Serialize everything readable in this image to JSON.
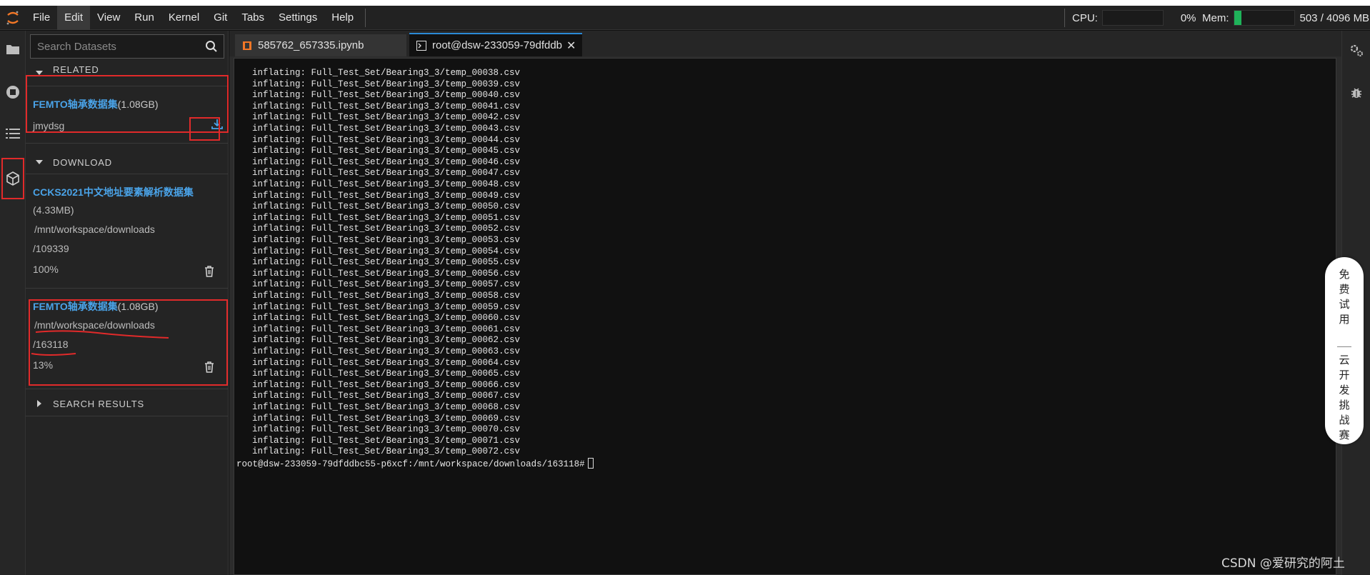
{
  "menubar": {
    "items": [
      "File",
      "Edit",
      "View",
      "Run",
      "Kernel",
      "Git",
      "Tabs",
      "Settings",
      "Help"
    ],
    "active": "Edit",
    "cpu": {
      "label": "CPU:",
      "percent_text": "0%",
      "usage": 0.0
    },
    "mem": {
      "label": "Mem:",
      "value_text": "503 / 4096 MB",
      "usage": 0.12
    }
  },
  "sidebar": {
    "search_placeholder": "Search Datasets",
    "related": {
      "header": "RELATED",
      "item": {
        "name": "FEMTO轴承数据集",
        "size": "(1.08GB)",
        "owner": "jmydsg"
      }
    },
    "download": {
      "header": "DOWNLOAD",
      "items": [
        {
          "name": "CCKS2021中文地址要素解析数据集",
          "size": "(4.33MB)",
          "path1": "/mnt/workspace/downloads",
          "path2": "/109339",
          "progress": "100%"
        },
        {
          "name": "FEMTO轴承数据集",
          "size": "(1.08GB)",
          "path1": "/mnt/workspace/downloads",
          "path2": "/163118",
          "progress": "13%"
        }
      ]
    },
    "search_results": {
      "header": "SEARCH RESULTS"
    }
  },
  "tabs": [
    {
      "label": "585762_657335.ipynb",
      "active": false
    },
    {
      "label": "root@dsw-233059-79dfddb",
      "active": true
    }
  ],
  "terminal": {
    "lines": [
      "  inflating: Full_Test_Set/Bearing3_3/temp_00038.csv",
      "  inflating: Full_Test_Set/Bearing3_3/temp_00039.csv",
      "  inflating: Full_Test_Set/Bearing3_3/temp_00040.csv",
      "  inflating: Full_Test_Set/Bearing3_3/temp_00041.csv",
      "  inflating: Full_Test_Set/Bearing3_3/temp_00042.csv",
      "  inflating: Full_Test_Set/Bearing3_3/temp_00043.csv",
      "  inflating: Full_Test_Set/Bearing3_3/temp_00044.csv",
      "  inflating: Full_Test_Set/Bearing3_3/temp_00045.csv",
      "  inflating: Full_Test_Set/Bearing3_3/temp_00046.csv",
      "  inflating: Full_Test_Set/Bearing3_3/temp_00047.csv",
      "  inflating: Full_Test_Set/Bearing3_3/temp_00048.csv",
      "  inflating: Full_Test_Set/Bearing3_3/temp_00049.csv",
      "  inflating: Full_Test_Set/Bearing3_3/temp_00050.csv",
      "  inflating: Full_Test_Set/Bearing3_3/temp_00051.csv",
      "  inflating: Full_Test_Set/Bearing3_3/temp_00052.csv",
      "  inflating: Full_Test_Set/Bearing3_3/temp_00053.csv",
      "  inflating: Full_Test_Set/Bearing3_3/temp_00054.csv",
      "  inflating: Full_Test_Set/Bearing3_3/temp_00055.csv",
      "  inflating: Full_Test_Set/Bearing3_3/temp_00056.csv",
      "  inflating: Full_Test_Set/Bearing3_3/temp_00057.csv",
      "  inflating: Full_Test_Set/Bearing3_3/temp_00058.csv",
      "  inflating: Full_Test_Set/Bearing3_3/temp_00059.csv",
      "  inflating: Full_Test_Set/Bearing3_3/temp_00060.csv",
      "  inflating: Full_Test_Set/Bearing3_3/temp_00061.csv",
      "  inflating: Full_Test_Set/Bearing3_3/temp_00062.csv",
      "  inflating: Full_Test_Set/Bearing3_3/temp_00063.csv",
      "  inflating: Full_Test_Set/Bearing3_3/temp_00064.csv",
      "  inflating: Full_Test_Set/Bearing3_3/temp_00065.csv",
      "  inflating: Full_Test_Set/Bearing3_3/temp_00066.csv",
      "  inflating: Full_Test_Set/Bearing3_3/temp_00067.csv",
      "  inflating: Full_Test_Set/Bearing3_3/temp_00068.csv",
      "  inflating: Full_Test_Set/Bearing3_3/temp_00069.csv",
      "  inflating: Full_Test_Set/Bearing3_3/temp_00070.csv",
      "  inflating: Full_Test_Set/Bearing3_3/temp_00071.csv",
      "  inflating: Full_Test_Set/Bearing3_3/temp_00072.csv"
    ],
    "prompt": "root@dsw-233059-79dfddbc55-p6xcf:/mnt/workspace/downloads/163118#"
  },
  "promo": {
    "top": "免费试用",
    "bottom": "云开发挑战赛"
  },
  "watermark": "CSDN @爱研究的阿土",
  "colors": {
    "accent": "#2b8ad6",
    "link": "#4aa3e8",
    "highlight": "#e12a2a",
    "mem_bar": "#1fb35a"
  }
}
